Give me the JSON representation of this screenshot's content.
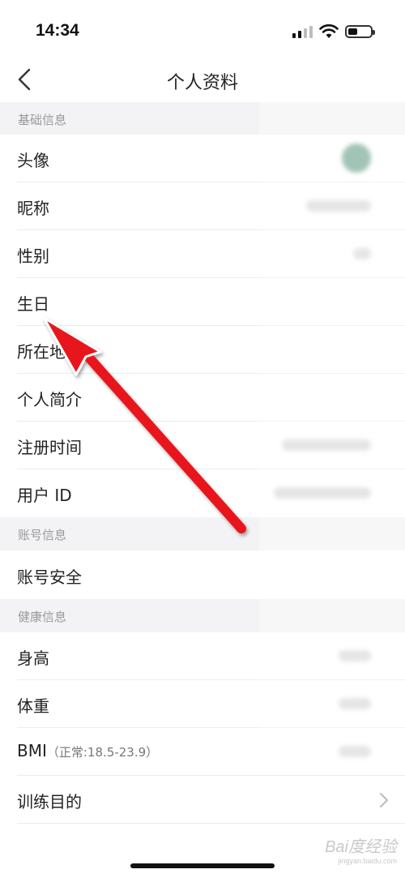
{
  "status_bar": {
    "time": "14:34"
  },
  "nav": {
    "title": "个人资料"
  },
  "sections": {
    "basic": "基础信息",
    "account": "账号信息",
    "health": "健康信息"
  },
  "rows": {
    "avatar": "头像",
    "nickname": "昵称",
    "gender": "性别",
    "birthday": "生日",
    "location": "所在地",
    "intro": "个人简介",
    "register_time": "注册时间",
    "user_id": "用户 ID",
    "account_security": "账号安全",
    "height": "身高",
    "weight": "体重",
    "bmi": "BMI",
    "bmi_note": "（正常:18.5-23.9）",
    "training_goal": "训练目的"
  },
  "watermark": {
    "brand": "Bai度经验",
    "url": "jingyan.baidu.com"
  },
  "colors": {
    "arrow": "#e8141b",
    "section_bg": "#f3f3f5"
  }
}
